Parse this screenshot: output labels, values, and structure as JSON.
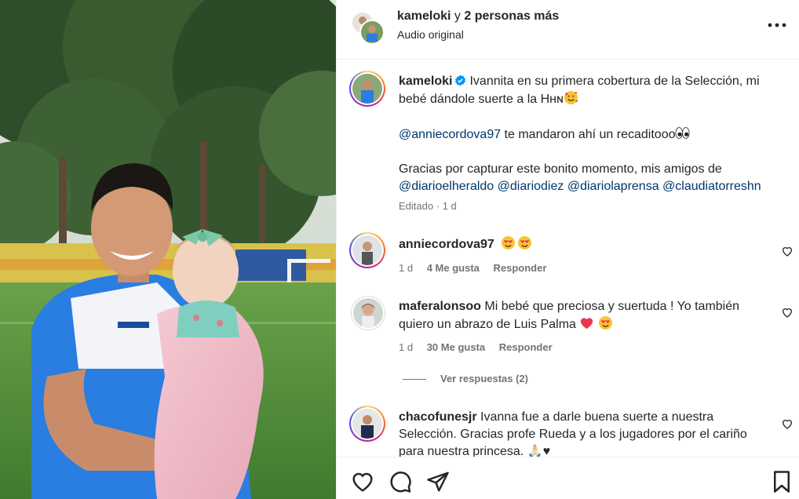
{
  "header": {
    "username": "kameloki",
    "joiner": " y ",
    "others": "2 personas más",
    "audio": "Audio original"
  },
  "caption": {
    "username": "kameloki",
    "line1": "Ivannita en su primera cobertura de la Selección, mi",
    "line2": "bebé dándole suerte a la Hʜɴ",
    "mention_line_user": "@anniecordova97",
    "mention_line_text": " te mandaron ahí un recaditooo",
    "thanks": "Gracias por capturar este bonito momento, mis amigos de",
    "tags": [
      "@diarioelheraldo",
      "@diariodiez",
      "@diariolaprensa",
      "@claudiatorreshn"
    ],
    "edited": "Editado",
    "dot": "·",
    "time": "1 d"
  },
  "comments": [
    {
      "username": "anniecordova97",
      "text": "",
      "time": "1 d",
      "likes": "4 Me gusta",
      "reply": "Responder"
    },
    {
      "username": "maferalonsoo",
      "line1": "Mi bebé que preciosa y suertuda ! Yo también",
      "line2": "quiero un abrazo de Luis Palma",
      "time": "1 d",
      "likes": "30 Me gusta",
      "reply": "Responder"
    },
    {
      "username": "chacofunesjr",
      "line1": "Ivanna fue a darle buena suerte a nuestra",
      "line2": "Selección. Gracias profe Rueda y a los jugadores por el cariño",
      "line3": "para nuestra princesa. 🙏🏻♥"
    }
  ],
  "view_replies": "Ver respuestas (2)",
  "icons": {
    "more": "more-options-icon",
    "like": "heart-icon",
    "comment": "comment-icon",
    "share": "share-icon",
    "save": "bookmark-icon",
    "verified": "verified-badge-icon"
  },
  "colors": {
    "text": "#262626",
    "secondary": "#737373",
    "link": "#00376b",
    "verified": "#0095f6",
    "divider": "#efefef"
  }
}
